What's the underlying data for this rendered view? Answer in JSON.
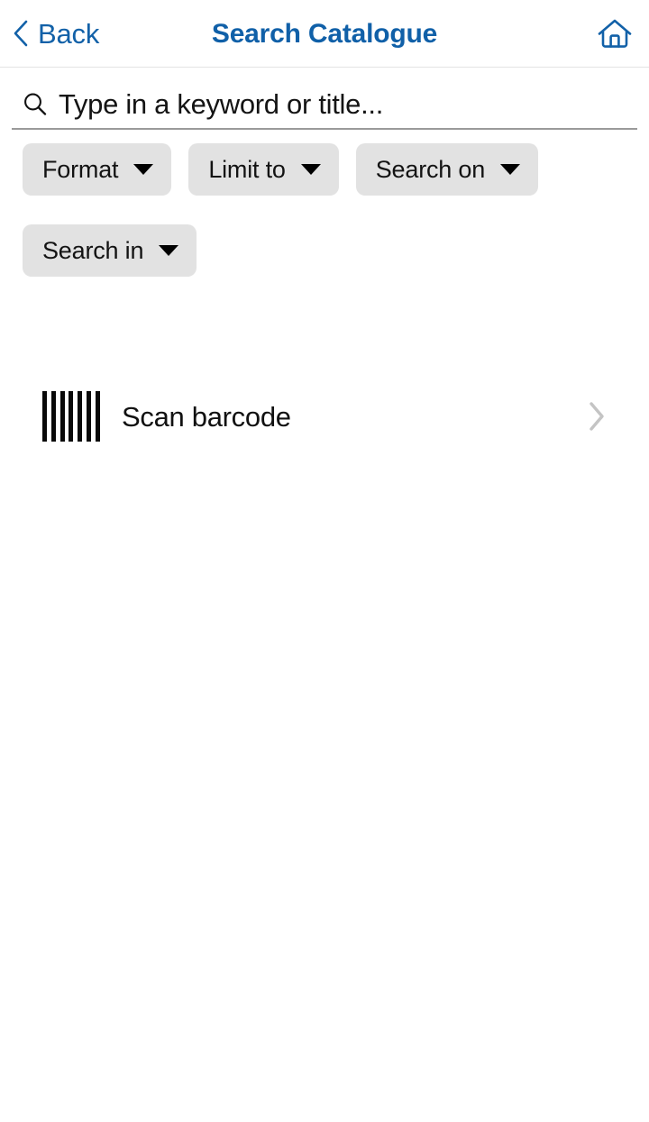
{
  "header": {
    "back_label": "Back",
    "title": "Search Catalogue",
    "back_icon": "chevron-left-icon",
    "home_icon": "home-icon",
    "title_color": "#1060a8",
    "link_color": "#1261a8"
  },
  "search": {
    "placeholder": "Type in a keyword or title...",
    "value": "",
    "icon": "search-icon"
  },
  "filters": {
    "rows": [
      [
        {
          "label": "Format",
          "caret_icon": "chevron-down-icon"
        },
        {
          "label": "Limit to",
          "caret_icon": "chevron-down-icon"
        },
        {
          "label": "Search on",
          "caret_icon": "chevron-down-icon"
        }
      ],
      [
        {
          "label": "Search in",
          "caret_icon": "chevron-down-icon"
        }
      ]
    ],
    "chip_background": "#e2e2e2",
    "chip_text_color": "#131313"
  },
  "scan": {
    "label": "Scan barcode",
    "icon": "barcode-icon",
    "chevron_icon": "chevron-right-icon",
    "bar_count": 7,
    "chevron_color": "#c4c4c4"
  }
}
